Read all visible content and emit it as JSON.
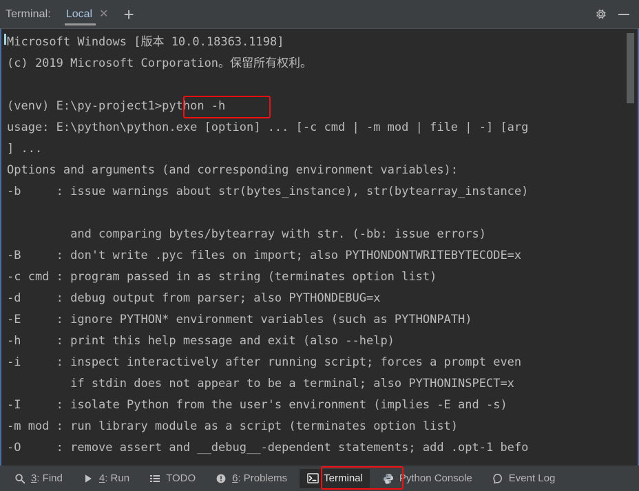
{
  "header": {
    "label": "Terminal:",
    "tab": {
      "name": "Local",
      "close_icon": "close-x-icon"
    },
    "add_tab_icon": "plus-icon",
    "settings_icon": "gear-icon",
    "minimize_icon": "minimize-icon"
  },
  "terminal": {
    "lines": [
      "Microsoft Windows [版本 10.0.18363.1198]",
      "(c) 2019 Microsoft Corporation。保留所有权利。",
      "",
      "(venv) E:\\py-project1>python -h",
      "usage: E:\\python\\python.exe [option] ... [-c cmd | -m mod | file | -] [arg",
      "] ...",
      "Options and arguments (and corresponding environment variables):",
      "-b     : issue warnings about str(bytes_instance), str(bytearray_instance)",
      "",
      "         and comparing bytes/bytearray with str. (-bb: issue errors)",
      "-B     : don't write .pyc files on import; also PYTHONDONTWRITEBYTECODE=x",
      "-c cmd : program passed in as string (terminates option list)",
      "-d     : debug output from parser; also PYTHONDEBUG=x",
      "-E     : ignore PYTHON* environment variables (such as PYTHONPATH)",
      "-h     : print this help message and exit (also --help)",
      "-i     : inspect interactively after running script; forces a prompt even",
      "         if stdin does not appear to be a terminal; also PYTHONINSPECT=x",
      "-I     : isolate Python from the user's environment (implies -E and -s)",
      "-m mod : run library module as a script (terminates option list)",
      "-O     : remove assert and __debug__-dependent statements; add .opt-1 befo"
    ],
    "command": "python -h",
    "prompt": "(venv) E:\\py-project1>"
  },
  "statusbar": {
    "items": [
      {
        "icon": "search-icon",
        "mnemonic": "3",
        "label": ": Find",
        "active": false
      },
      {
        "icon": "play-icon",
        "mnemonic": "4",
        "label": ": Run",
        "active": false
      },
      {
        "icon": "list-icon",
        "mnemonic": "",
        "label": "TODO",
        "active": false
      },
      {
        "icon": "exclamation-circle-icon",
        "mnemonic": "6",
        "label": ": Problems",
        "active": false
      },
      {
        "icon": "terminal-icon",
        "mnemonic": "",
        "label": "Terminal",
        "active": true
      },
      {
        "icon": "python-icon",
        "mnemonic": "",
        "label": "Python Console",
        "active": false
      },
      {
        "icon": "event-log-icon",
        "mnemonic": "",
        "label": "Event Log",
        "active": false
      }
    ]
  },
  "annotations": {
    "command_highlight": "python -h",
    "terminal_tab_highlight": "Terminal",
    "color": "#f01010"
  },
  "colors": {
    "panel_bg": "#3c3f41",
    "terminal_bg": "#2b2b2b",
    "terminal_text": "#bbbbbb",
    "tab_text": "#a8c5e0",
    "focus_border": "#4a6fa5",
    "annotation_red": "#f01010"
  }
}
